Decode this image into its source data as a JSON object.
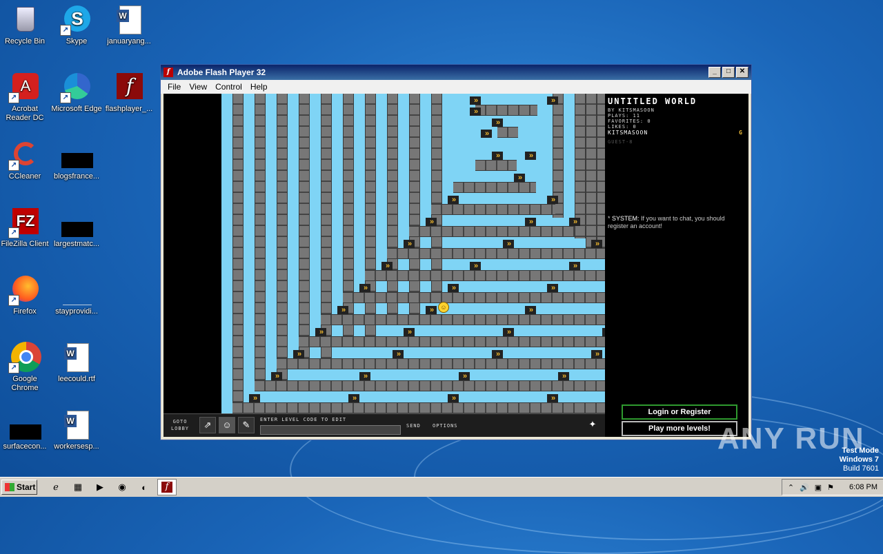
{
  "desktop": {
    "icons": [
      {
        "label": "Recycle Bin"
      },
      {
        "label": "Skype"
      },
      {
        "label": "januaryang..."
      },
      {
        "label": "Acrobat Reader DC"
      },
      {
        "label": "Microsoft Edge"
      },
      {
        "label": "flashplayer_..."
      },
      {
        "label": "CCleaner"
      },
      {
        "label": "blogsfrance..."
      },
      {
        "label": "FileZilla Client"
      },
      {
        "label": "largestmatc..."
      },
      {
        "label": "Firefox"
      },
      {
        "label": "stayprovidi..."
      },
      {
        "label": "Google Chrome"
      },
      {
        "label": "leecould.rtf"
      },
      {
        "label": "surfacecon..."
      },
      {
        "label": "workersesp..."
      }
    ]
  },
  "window": {
    "title": "Adobe Flash Player 32",
    "menu": [
      "File",
      "View",
      "Control",
      "Help"
    ]
  },
  "game": {
    "world_title": "UNTITLED WORLD",
    "by": "BY KITSMASOON",
    "plays": "PLAYS: 11",
    "favorites": "FAVORITES: 0",
    "likes": "LIKES: 0",
    "user": "KITSMASOON",
    "user_badge": "G",
    "guest": "GUEST-8",
    "chat_sender": "SYSTEM:",
    "chat_message": "If you want to chat, you should register an account!",
    "login_button": "Login or Register",
    "more_levels_button": "Play more levels!",
    "bottom": {
      "goto_lobby": "GOTO LOBBY",
      "code_label": "ENTER LEVEL CODE TO EDIT",
      "send": "SEND",
      "options": "OPTIONS"
    }
  },
  "taskbar": {
    "start_label": "Start",
    "time": "6:08 PM"
  },
  "watermark": {
    "mode": "Test Mode",
    "os": "Windows 7",
    "build": "Build 7601",
    "brand": "ANY RUN"
  }
}
